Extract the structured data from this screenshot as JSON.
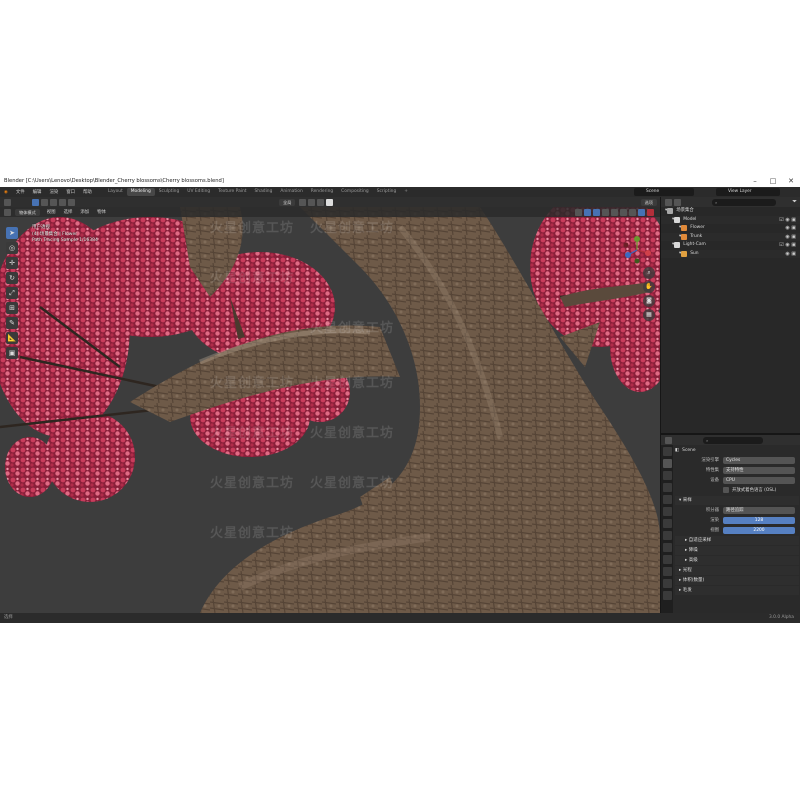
{
  "window": {
    "title": "Blender [C:\\Users\\Lenovo\\Desktop\\Blender_Cherry blossoms\\Cherry blossoms.blend]"
  },
  "menu": [
    "文件",
    "编辑",
    "渲染",
    "窗口",
    "帮助"
  ],
  "workspaces": [
    "Layout",
    "Modeling",
    "Sculpting",
    "UV Editing",
    "Texture Paint",
    "Shading",
    "Animation",
    "Rendering",
    "Compositing",
    "Scripting"
  ],
  "active_workspace": "Modeling",
  "scene_selector": "Scene",
  "view_layer_selector": "View Layer",
  "viewport_header": {
    "mode": "物体模式",
    "menus": [
      "视图",
      "选择",
      "添加",
      "物体"
    ],
    "transform": "全局",
    "options": "选项"
  },
  "viewport_overlay": {
    "line1": "用户透视",
    "line2": "(4) 场景集合 | Flower",
    "line3": "Path Tracing Sample 1/16384"
  },
  "watermark": "火星创意工坊",
  "outliner": {
    "search_placeholder": "",
    "items": [
      {
        "label": "场景集合",
        "indent": 0,
        "icon_color": "#a8a8a8",
        "vis": ""
      },
      {
        "label": "Model",
        "indent": 1,
        "icon_color": "#d8d8d8",
        "vis": "☑ ◉ ▣"
      },
      {
        "label": "Flower",
        "indent": 2,
        "icon_color": "#e08a3a",
        "vis": "◉ ▣"
      },
      {
        "label": "Trunk",
        "indent": 2,
        "icon_color": "#e08a3a",
        "vis": "◉ ▣"
      },
      {
        "label": "Light-Cam",
        "indent": 1,
        "icon_color": "#d8d8d8",
        "vis": "☑ ◉ ▣"
      },
      {
        "label": "Sun",
        "indent": 2,
        "icon_color": "#e0a040",
        "vis": "◉ ▣"
      }
    ]
  },
  "properties": {
    "scene_label": "Scene",
    "render_engine_label": "渲染引擎",
    "render_engine": "Cycles",
    "feature_set_label": "特性集",
    "feature_set": "支持特性",
    "device_label": "设备",
    "device": "CPU",
    "osl_label": "开放式着色语言 (OSL)",
    "sampling_section": "采样",
    "integrator_label": "积分器",
    "integrator": "路径追踪",
    "render_label": "渲染",
    "render_samples": "128",
    "viewport_label": "视图",
    "viewport_samples": "2200",
    "sub_sections": [
      "自适应采样",
      "降噪",
      "高级"
    ],
    "sections": [
      "光程",
      "体积(数量)",
      "毛发"
    ]
  },
  "status": {
    "left": "选择",
    "version": "3.0.0 Alpha"
  },
  "colors": {
    "accent": "#4772b3",
    "blossom": "#c03a5a",
    "trunk": "#6e5a48",
    "bg": "#3d3d3d"
  }
}
